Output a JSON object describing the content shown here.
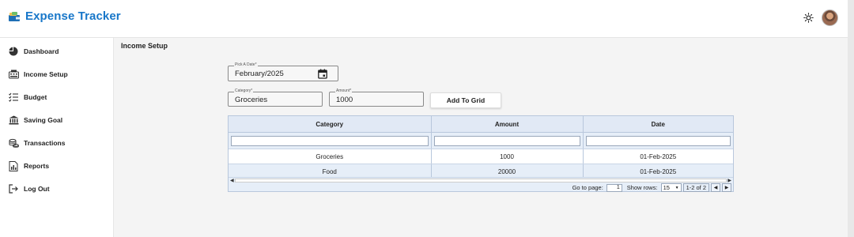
{
  "app": {
    "title": "Expense Tracker"
  },
  "header": {
    "theme_icon": "sun-icon",
    "avatar_icon": "user-avatar"
  },
  "sidebar": {
    "items": [
      {
        "label": "Dashboard",
        "icon": "pie-chart-icon"
      },
      {
        "label": "Income Setup",
        "icon": "keyboard-icon"
      },
      {
        "label": "Budget",
        "icon": "checklist-icon"
      },
      {
        "label": "Saving Goal",
        "icon": "bank-icon"
      },
      {
        "label": "Transactions",
        "icon": "coins-icon"
      },
      {
        "label": "Reports",
        "icon": "report-icon"
      },
      {
        "label": "Log Out",
        "icon": "logout-icon"
      }
    ]
  },
  "main": {
    "title": "Income Setup",
    "date_field": {
      "label": "Pick A Date",
      "required": "*",
      "value": "February/2025"
    },
    "category_field": {
      "label": "Category",
      "required": "*",
      "value": "Groceries"
    },
    "amount_field": {
      "label": "Amount",
      "required": "*",
      "value": "1000"
    },
    "add_button": "Add To Grid",
    "grid": {
      "columns": [
        "Category",
        "Amount",
        "Date"
      ],
      "rows": [
        [
          "Groceries",
          "1000",
          "01-Feb-2025"
        ],
        [
          "Food",
          "20000",
          "01-Feb-2025"
        ]
      ],
      "pager": {
        "go_to_label": "Go to page:",
        "page_value": "1",
        "show_rows_label": "Show rows:",
        "rows_value": "15",
        "range_text": "1-2 of 2"
      }
    }
  },
  "colors": {
    "brand": "#1877c9",
    "grid_bg": "#e6eef8",
    "grid_border": "#b8c7dc"
  }
}
